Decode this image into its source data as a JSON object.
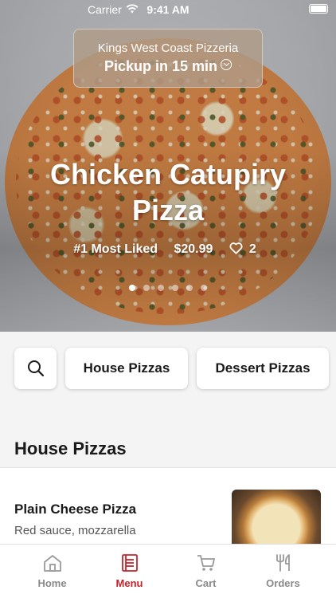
{
  "status_bar": {
    "carrier": "Carrier",
    "time": "9:41 AM"
  },
  "store": {
    "name": "Kings West Coast Pizzeria",
    "pickup": "Pickup in 15 min"
  },
  "featured": {
    "title_line1": "Chicken Catupiry",
    "title_line2": "Pizza",
    "badge": "#1 Most Liked",
    "price": "$20.99",
    "likes": "2",
    "carousel_total": 6,
    "carousel_active_index": 0
  },
  "categories": [
    {
      "label": "House Pizzas"
    },
    {
      "label": "Dessert Pizzas"
    }
  ],
  "section": {
    "title": "House Pizzas"
  },
  "items": [
    {
      "name": "Plain Cheese Pizza",
      "description": "Red sauce, mozzarella"
    }
  ],
  "tabs": [
    {
      "label": "Home",
      "icon": "home-icon"
    },
    {
      "label": "Menu",
      "icon": "menu-icon",
      "active": true
    },
    {
      "label": "Cart",
      "icon": "cart-icon"
    },
    {
      "label": "Orders",
      "icon": "orders-icon"
    }
  ],
  "colors": {
    "accent": "#c8232c",
    "inactive_tab": "#8a8a8a"
  }
}
